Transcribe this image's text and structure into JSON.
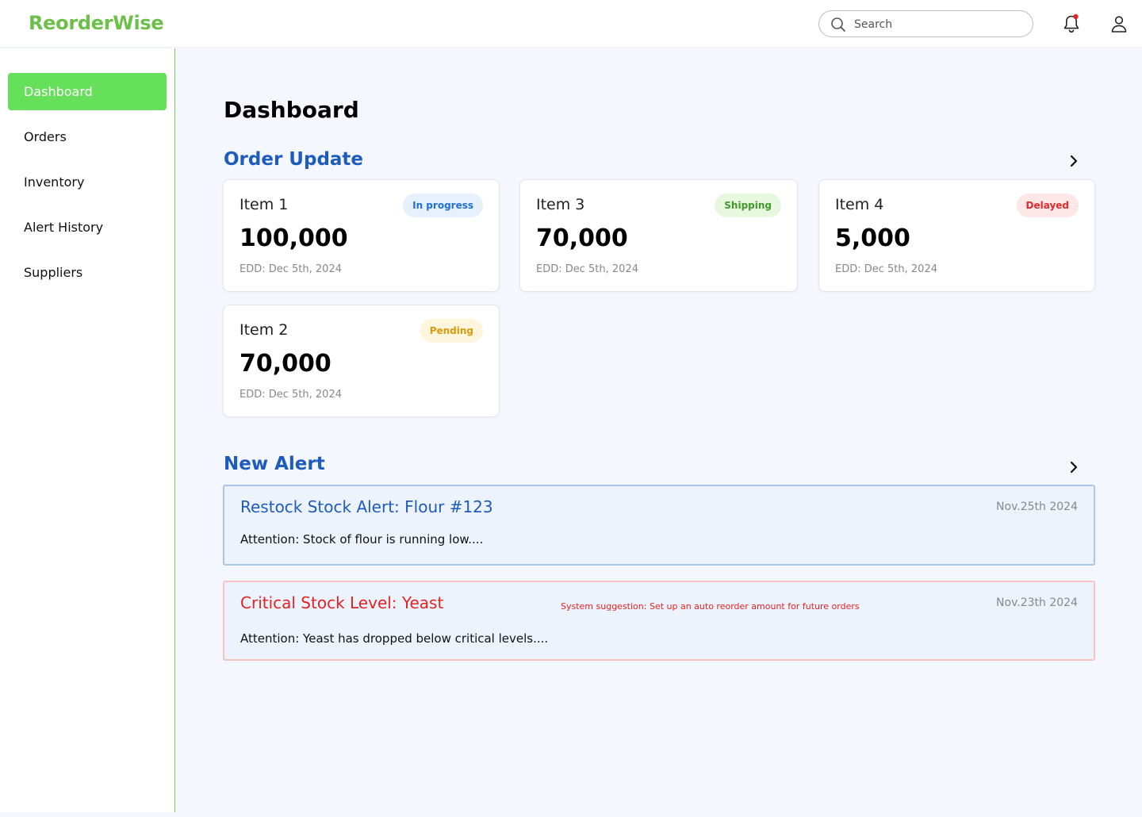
{
  "app": {
    "name": "ReorderWise"
  },
  "header": {
    "search_placeholder": "Search",
    "search_value": ""
  },
  "sidebar": {
    "items": [
      {
        "label": "Dashboard",
        "active": true
      },
      {
        "label": "Orders",
        "active": false
      },
      {
        "label": "Inventory",
        "active": false
      },
      {
        "label": "Alert History",
        "active": false
      },
      {
        "label": "Suppliers",
        "active": false
      }
    ]
  },
  "page": {
    "title": "Dashboard"
  },
  "orders": {
    "title": "Order Update",
    "cards": [
      {
        "name": "Item 1",
        "quantity": "100,000",
        "edd": "EDD: Dec 5th, 2024",
        "status": "In progress",
        "status_color": "#1e6fd9",
        "status_bg": "#e6f1fd"
      },
      {
        "name": "Item 3",
        "quantity": "70,000",
        "edd": "EDD: Dec 5th, 2024",
        "status": "Shipping",
        "status_color": "#3f9a2a",
        "status_bg": "#e7f8df"
      },
      {
        "name": "Item 4",
        "quantity": "5,000",
        "edd": "EDD: Dec 5th, 2024",
        "status": "Delayed",
        "status_color": "#e02b2b",
        "status_bg": "#fde7e7"
      },
      {
        "name": "Item 2",
        "quantity": "70,000",
        "edd": "EDD: Dec 5th, 2024",
        "status": "Pending",
        "status_color": "#d99a0b",
        "status_bg": "#fdf5dc"
      }
    ]
  },
  "alerts": {
    "title": "New Alert",
    "items": [
      {
        "title": "Restock Stock Alert: Flour #123",
        "date": "Nov.25th 2024",
        "body": "Attention: Stock of flour is running low....",
        "title_color": "#1e5bbf",
        "border_color": "#a9c6ee"
      },
      {
        "title": "Critical Stock Level: Yeast",
        "date": "Nov.23th 2024",
        "body": "Attention: Yeast has dropped below critical levels....",
        "suggestion": "System suggestion: Set up an auto reorder amount for future orders",
        "title_color": "#e52222",
        "border_color": "#f6c3c3"
      }
    ]
  },
  "colors": {
    "brand_green": "#6cc04a",
    "active_nav": "#66e05a",
    "section_blue": "#1e5bbf",
    "background": "#f4f7fd"
  }
}
